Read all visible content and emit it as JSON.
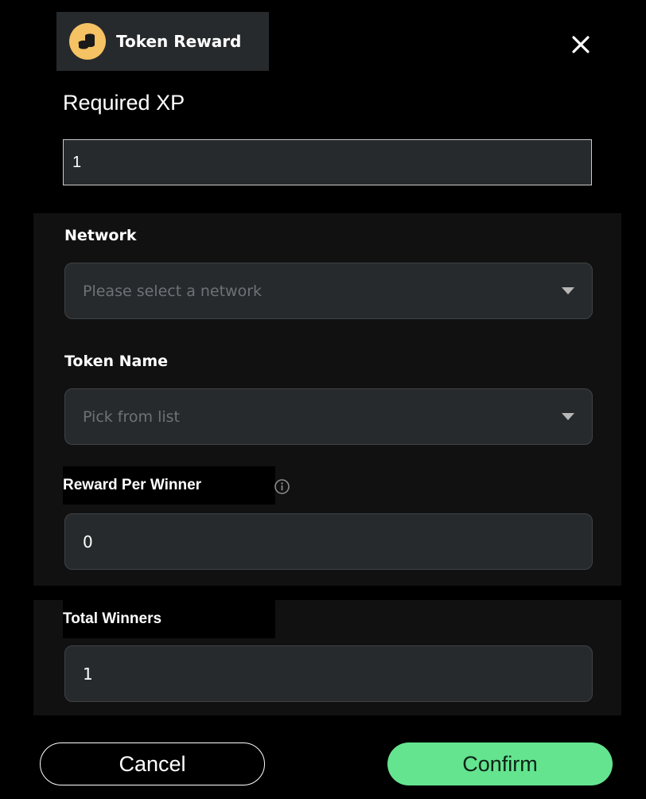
{
  "header": {
    "title": "Token Reward",
    "icon": "coins-icon",
    "coin_color": "#f5c264"
  },
  "close": {
    "icon": "close-icon"
  },
  "required_xp": {
    "label": "Required XP",
    "value": "1"
  },
  "network": {
    "label": "Network",
    "placeholder": "Please select a network"
  },
  "token_name": {
    "label": "Token Name",
    "placeholder": "Pick from list"
  },
  "reward_per_winner": {
    "label": "Reward Per Winner",
    "value": "0",
    "info_icon": "info-icon"
  },
  "total_winners": {
    "label": "Total Winners",
    "value": "1"
  },
  "actions": {
    "cancel_label": "Cancel",
    "confirm_label": "Confirm",
    "confirm_color": "#64e48f"
  }
}
